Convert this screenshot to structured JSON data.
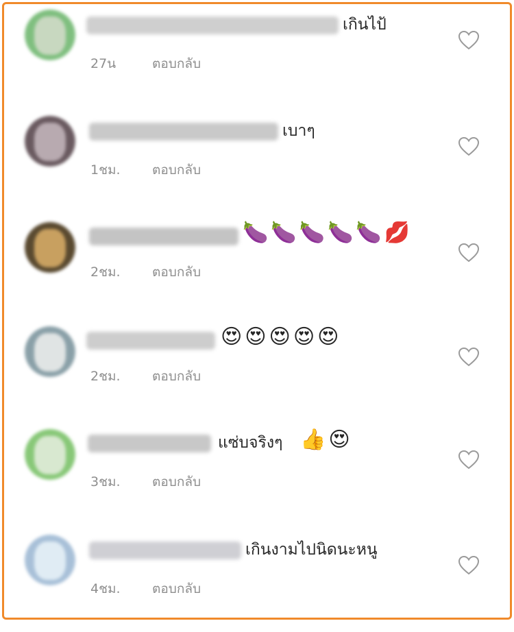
{
  "comments": [
    {
      "text": "เกินไป้",
      "emoji": "",
      "time": "27น",
      "reply": "ตอบกลับ",
      "avatar_colors": [
        "#7fbf7f",
        "#c8d8c0"
      ],
      "username_color": "#cfcfcf"
    },
    {
      "text": "เบาๆ",
      "emoji": "",
      "time": "1ชม.",
      "reply": "ตอบกลับ",
      "avatar_colors": [
        "#6a5a60",
        "#b8aab0"
      ],
      "username_color": "#c9c9c9"
    },
    {
      "text": "",
      "emoji": "🍆🍆🍆🍆🍆💋",
      "time": "2ชม.",
      "reply": "ตอบกลับ",
      "avatar_colors": [
        "#5a4a30",
        "#c8a060"
      ],
      "username_color": "#c4c4c4"
    },
    {
      "text": "",
      "emoji": "😍😍😍😍😍",
      "time": "2ชม.",
      "reply": "ตอบกลับ",
      "avatar_colors": [
        "#8aa0a8",
        "#e0e4e4"
      ],
      "username_color": "#cdcdcd"
    },
    {
      "text": "แซ่บจริงๆ",
      "emoji": "👍😍",
      "time": "3ชม.",
      "reply": "ตอบกลับ",
      "avatar_colors": [
        "#88c878",
        "#d8e8d0"
      ],
      "username_color": "#c8c8c8"
    },
    {
      "text": "เกินงามไปนิดนะหนู",
      "emoji": "",
      "time": "4ชม.",
      "reply": "ตอบกลับ",
      "avatar_colors": [
        "#a8c0d8",
        "#e0ecf4"
      ],
      "username_color": "#cfcfd4"
    }
  ],
  "icons": {
    "like": "heart-outline-icon"
  },
  "colors": {
    "frame_border": "#f08a2a",
    "meta_text": "#8e8e8e",
    "heart_stroke": "#9a9a9a"
  }
}
